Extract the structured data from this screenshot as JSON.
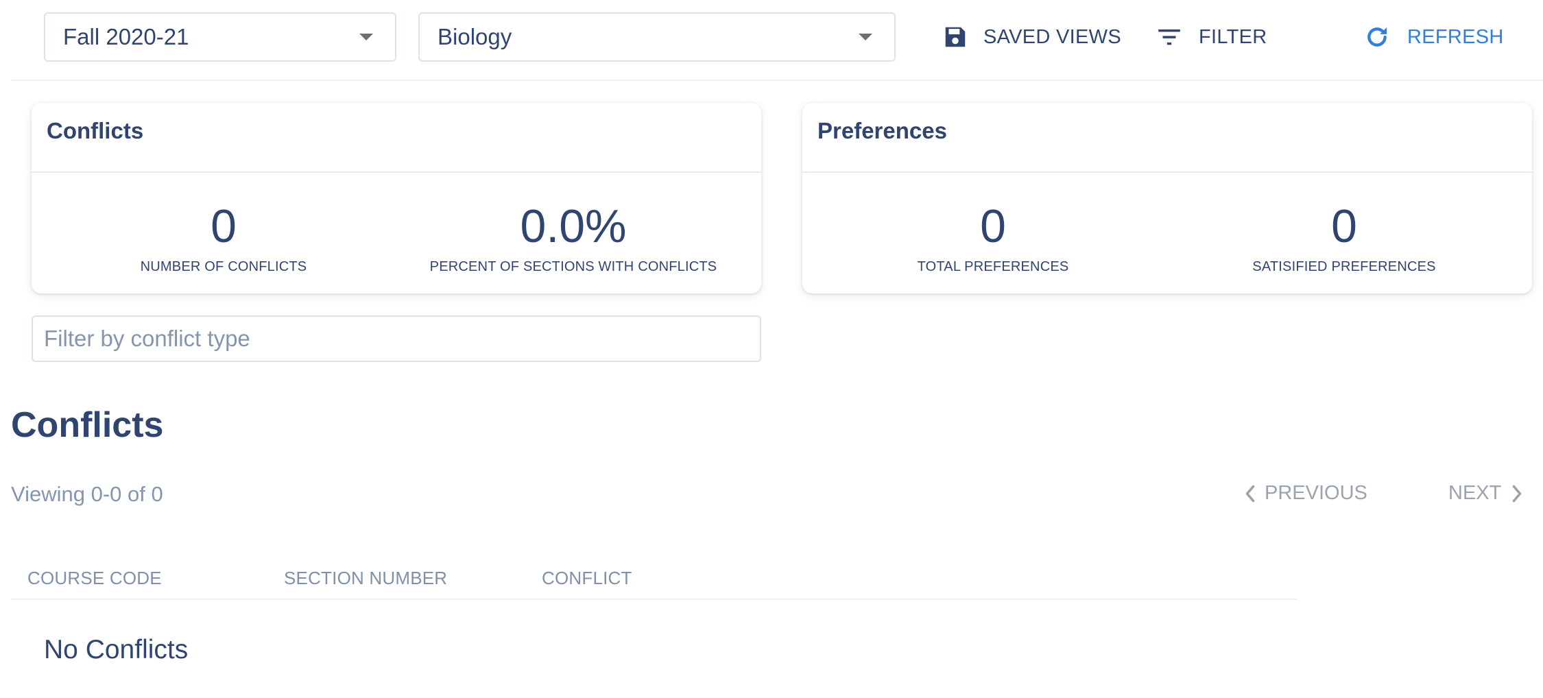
{
  "toolbar": {
    "term_select": {
      "value": "Fall 2020-21"
    },
    "department_select": {
      "value": "Biology"
    },
    "saved_views_label": "SAVED VIEWS",
    "filter_label": "FILTER",
    "refresh_label": "REFRESH"
  },
  "conflicts_card": {
    "title": "Conflicts",
    "stats": [
      {
        "value": "0",
        "caption": "NUMBER OF CONFLICTS"
      },
      {
        "value": "0.0%",
        "caption": "PERCENT OF SECTIONS WITH CONFLICTS"
      }
    ]
  },
  "preferences_card": {
    "title": "Preferences",
    "stats": [
      {
        "value": "0",
        "caption": "TOTAL PREFERENCES"
      },
      {
        "value": "0",
        "caption": "SATISIFIED PREFERENCES"
      }
    ]
  },
  "conflict_type_filter": {
    "placeholder": "Filter by conflict type"
  },
  "conflicts_section": {
    "title": "Conflicts",
    "viewing_text": "Viewing 0-0 of 0",
    "pagination": {
      "previous_label": "PREVIOUS",
      "next_label": "NEXT"
    },
    "table": {
      "columns": [
        "COURSE CODE",
        "SECTION NUMBER",
        "CONFLICT"
      ],
      "empty_message": "No Conflicts"
    }
  },
  "colors": {
    "text_primary": "#2f4570",
    "text_muted": "#8495ad",
    "accent_blue": "#2f80d8",
    "disabled": "#9aa3ae"
  },
  "icons": {
    "saved_views": "floppy-disk-icon",
    "filter": "filter-lines-icon",
    "refresh": "refresh-icon",
    "previous": "chevron-left-icon",
    "next": "chevron-right-icon",
    "dropdown": "caret-down-icon"
  }
}
